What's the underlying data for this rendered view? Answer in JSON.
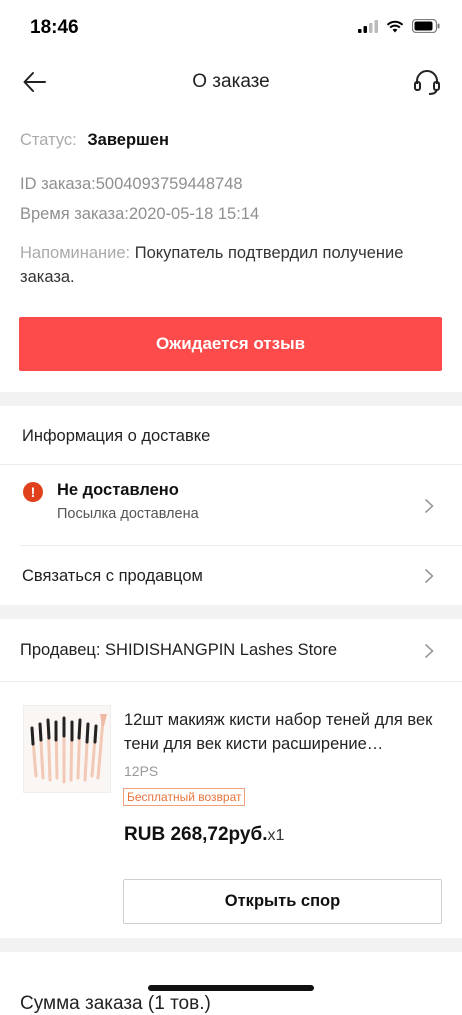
{
  "statusbar": {
    "time": "18:46"
  },
  "header": {
    "title": "О заказе"
  },
  "order": {
    "status_label": "Статус:",
    "status_value": "Завершен",
    "id_line": "ID заказа:5004093759448748",
    "time_line": "Время заказа:2020-05-18 15:14",
    "reminder_label": "Напоминание:",
    "reminder_text": " Покупатель подтвердил получение заказа."
  },
  "actions": {
    "review_button": "Ожидается отзыв"
  },
  "delivery": {
    "header": "Информация о доставке",
    "status_title": "Не доставлено",
    "status_subtitle": "Посылка доставлена",
    "contact_seller": "Связаться с продавцом"
  },
  "seller": {
    "label": "Продавец: SHIDISHANGPIN Lashes Store"
  },
  "product": {
    "name": "12шт макияж кисти набор теней для век тени для век кисти расширение…",
    "sku": "12PS",
    "badge": "Бесплатный возврат",
    "price": "RUB 268,72руб.",
    "qty": "x1",
    "dispute_button": "Открыть спор"
  },
  "summary": {
    "total_label": "Сумма заказа (1 тов.)"
  },
  "colors": {
    "accent": "#fd4a4a",
    "alert": "#e0401c",
    "badge": "#e8733a"
  },
  "icons": [
    "back-arrow-icon",
    "headset-icon",
    "alert-icon",
    "chevron-right-icon",
    "signal-icon",
    "wifi-icon",
    "battery-icon"
  ]
}
